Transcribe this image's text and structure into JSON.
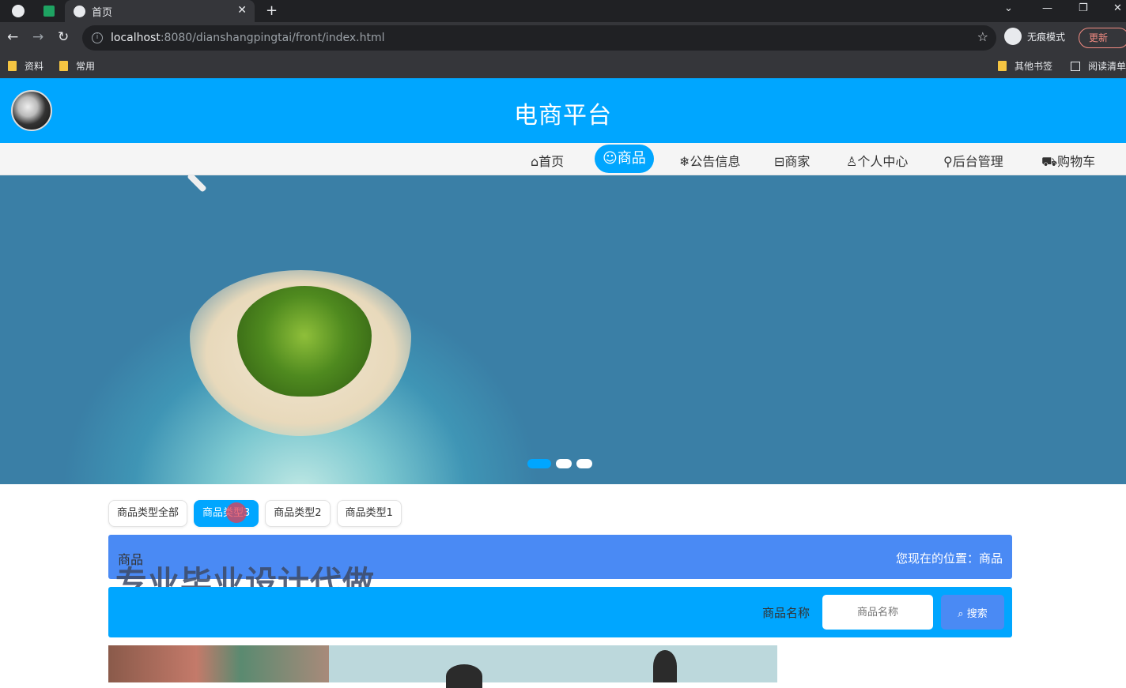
{
  "browser": {
    "tab_title": "首页",
    "close_glyph": "✕",
    "newtab_glyph": "+",
    "url_host": "localhost",
    "url_rest": ":8080/dianshangpingtai/front/index.html",
    "incognito_label": "无痕模式",
    "update_label": "更新",
    "bookmarks": [
      "资料",
      "常用"
    ],
    "other_bookmarks": "其他书签",
    "reading_list": "阅读清单"
  },
  "site": {
    "title": "电商平台"
  },
  "nav": {
    "items": [
      {
        "icon": "home-icon",
        "glyph": "⌂",
        "label": "首页"
      },
      {
        "icon": "goods-icon",
        "glyph": "☺",
        "label": "商品"
      },
      {
        "icon": "snowflake-icon",
        "glyph": "❄",
        "label": "公告信息"
      },
      {
        "icon": "merchant-icon",
        "glyph": "⊟",
        "label": "商家"
      },
      {
        "icon": "user-icon",
        "glyph": "♙",
        "label": "个人中心"
      },
      {
        "icon": "link-icon",
        "glyph": "⚲",
        "label": "后台管理"
      },
      {
        "icon": "cart-icon",
        "glyph": "⛟",
        "label": "购物车"
      }
    ],
    "active_index": 1
  },
  "categories": {
    "items": [
      "商品类型全部",
      "商品类型3",
      "商品类型2",
      "商品类型1"
    ],
    "active_index": 1
  },
  "breadcrumb": {
    "left": "商品",
    "right": "您现在的位置：商品"
  },
  "watermark": "专业毕业设计代做",
  "search": {
    "label": "商品名称",
    "placeholder": "商品名称",
    "button_label": "搜索",
    "button_icon": "search-icon"
  },
  "colors": {
    "primary": "#00a6ff",
    "accent": "#4a8af4"
  }
}
